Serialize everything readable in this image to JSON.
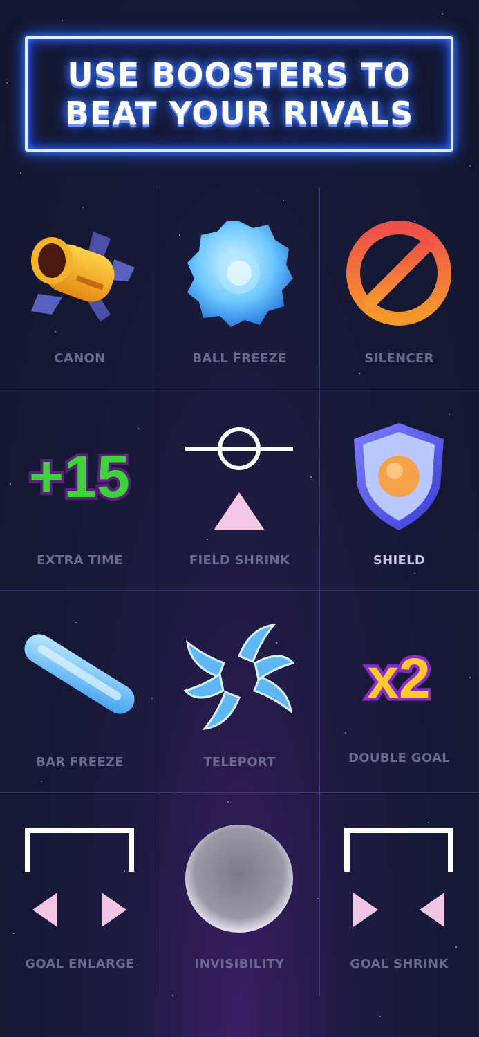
{
  "title": {
    "line1": "USE BOOSTERS TO",
    "line2": "BEAT YOUR RIVALS"
  },
  "boosters": [
    {
      "label": "CANON",
      "icon": "cannon-icon"
    },
    {
      "label": "BALL FREEZE",
      "icon": "frozen-ball-icon"
    },
    {
      "label": "SILENCER",
      "icon": "prohibited-sign-icon"
    },
    {
      "label": "EXTRA TIME",
      "icon": "plus-fifteen-icon"
    },
    {
      "label": "FIELD SHRINK",
      "icon": "field-shrink-icon"
    },
    {
      "label": "SHIELD",
      "icon": "shield-icon"
    },
    {
      "label": "BAR FREEZE",
      "icon": "frozen-bar-icon"
    },
    {
      "label": "TELEPORT",
      "icon": "portal-swirl-icon"
    },
    {
      "label": "DOUBLE GOAL",
      "icon": "times-two-icon"
    },
    {
      "label": "GOAL ENLARGE",
      "icon": "goal-enlarge-icon"
    },
    {
      "label": "INVISIBILITY",
      "icon": "invisible-ball-icon"
    },
    {
      "label": "GOAL SHRINK",
      "icon": "goal-shrink-icon"
    }
  ],
  "icon_texts": {
    "extra_time": "+15",
    "double_goal": "x2"
  },
  "colors": {
    "neon_border": "#dfe9ff",
    "neon_glow": "#2a62ff",
    "label": "#6b6a8f",
    "background": "#141833"
  }
}
